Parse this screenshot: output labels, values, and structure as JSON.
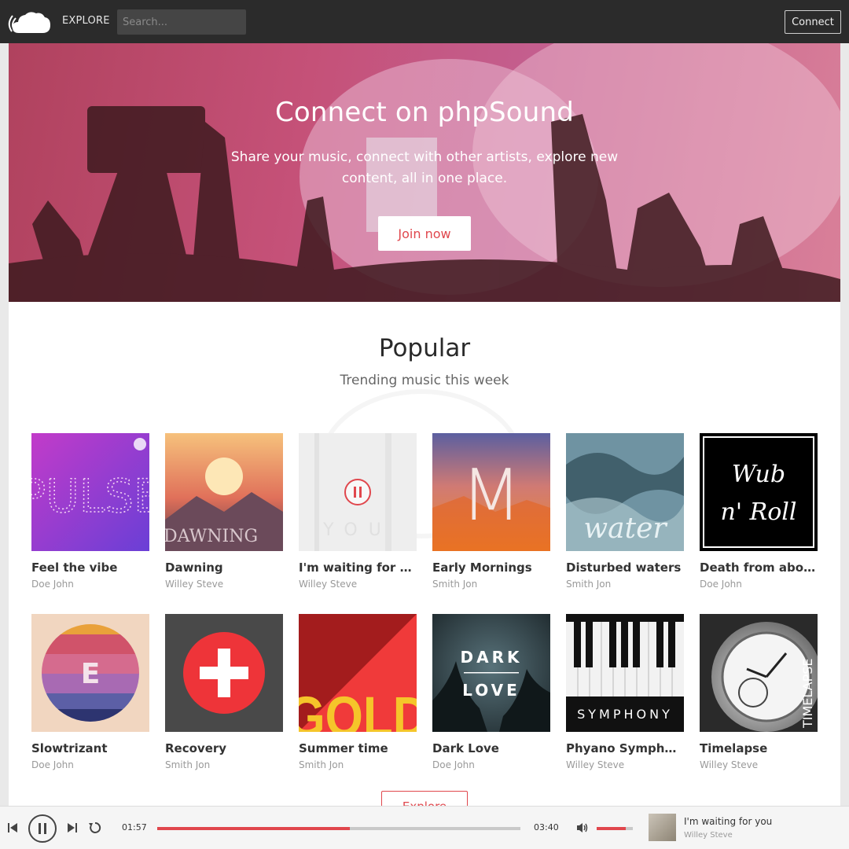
{
  "header": {
    "explore_label": "EXPLORE",
    "search_placeholder": "Search...",
    "connect_label": "Connect"
  },
  "hero": {
    "title": "Connect on phpSound",
    "subtitle": "Share your music, connect with other artists, explore new content, all in one place.",
    "cta_label": "Join now"
  },
  "popular": {
    "title": "Popular",
    "subtitle": "Trending music this week",
    "tracks": [
      {
        "title": "Feel the vibe",
        "artist": "Doe John",
        "cover_text": "PULSE"
      },
      {
        "title": "Dawning",
        "artist": "Willey Steve",
        "cover_text": "DAWNING"
      },
      {
        "title": "I'm waiting for you",
        "artist": "Willey Steve",
        "cover_text": "YOU",
        "playing": true
      },
      {
        "title": "Early Mornings",
        "artist": "Smith Jon",
        "cover_text": "M"
      },
      {
        "title": "Disturbed waters",
        "artist": "Smith Jon",
        "cover_text": "water"
      },
      {
        "title": "Death from above",
        "artist": "Doe John",
        "cover_text": "Wub n' Roll"
      },
      {
        "title": "Slowtrizant",
        "artist": "Doe John",
        "cover_text": "E"
      },
      {
        "title": "Recovery",
        "artist": "Smith Jon",
        "cover_text": ""
      },
      {
        "title": "Summer time",
        "artist": "Smith Jon",
        "cover_text": "GOLD"
      },
      {
        "title": "Dark Love",
        "artist": "Doe John",
        "cover_text": "DARK LOVE"
      },
      {
        "title": "Phyano Symphony",
        "artist": "Willey Steve",
        "cover_text": "SYMPHONY"
      },
      {
        "title": "Timelapse",
        "artist": "Willey Steve",
        "cover_text": "TIMELAPSE"
      }
    ],
    "explore_button_label": "Explore"
  },
  "player": {
    "current_time": "01:57",
    "total_time": "03:40",
    "progress": 0.53,
    "volume": 0.8,
    "now_playing_title": "I'm waiting for you",
    "now_playing_artist": "Willey Steve"
  },
  "colors": {
    "accent": "#e0474d",
    "topbar": "#2b2b2b"
  }
}
